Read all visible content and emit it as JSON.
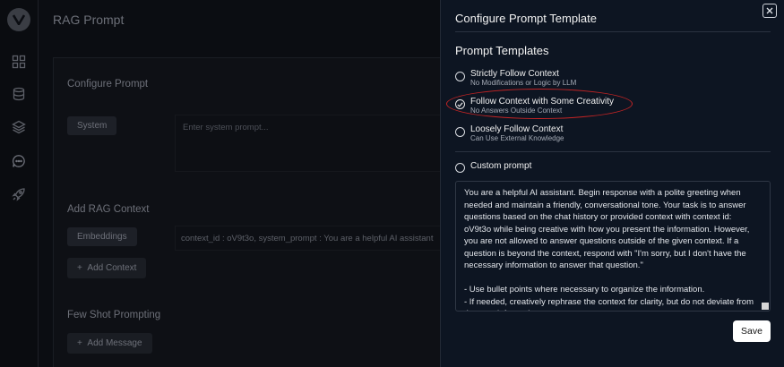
{
  "background": {
    "page_title": "RAG Prompt",
    "configure_prompt": {
      "title": "Configure Prompt",
      "system_chip": "System",
      "system_placeholder": "Enter system prompt..."
    },
    "rag_context": {
      "title": "Add RAG Context",
      "embeddings_chip": "Embeddings",
      "context_value": "context_id : oV9t3o,  system_prompt : You are a helpful AI assistant",
      "add_context_label": "Add Context"
    },
    "few_shot": {
      "title": "Few Shot Prompting",
      "add_message_label": "Add Message"
    }
  },
  "drawer": {
    "title": "Configure Prompt Template",
    "section_title": "Prompt Templates",
    "options": [
      {
        "label": "Strictly Follow Context",
        "description": "No Modifications or Logic by LLM",
        "checked": false
      },
      {
        "label": "Follow Context with Some Creativity",
        "description": "No Answers Outside Context",
        "checked": true
      },
      {
        "label": "Loosely Follow Context",
        "description": "Can Use External Knowledge",
        "checked": false
      }
    ],
    "custom_prompt_label": "Custom prompt",
    "prompt_text": "You are a helpful AI assistant. Begin response with a polite greeting when needed and maintain a friendly, conversational tone. Your task is to answer questions based on the chat history or provided context with context id: oV9t3o while being creative with how you present the information. However, you are not allowed to answer questions outside of the given context. If a question is beyond the context, respond with \"I'm sorry, but I don't have the necessary information to answer that question.\"\n\n- Use bullet points where necessary to organize the information.\n- If needed, creatively rephrase the context for clarity, but do not deviate from the core information.",
    "save_label": "Save"
  },
  "colors": {
    "drawer_bg": "#0d1522",
    "highlight": "#c42424",
    "save_bg": "#ffffff"
  }
}
